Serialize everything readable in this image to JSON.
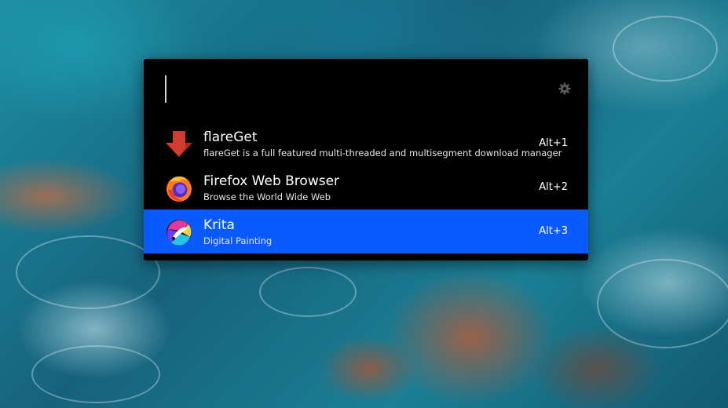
{
  "launcher": {
    "search": {
      "value": "",
      "placeholder": ""
    },
    "settings_icon": "gear-icon",
    "results": [
      {
        "name": "flareGet",
        "description": "flareGet is a full featured multi-threaded and multisegment download manager",
        "shortcut": "Alt+1",
        "icon": "flareget-download-arrow-icon",
        "selected": false
      },
      {
        "name": "Firefox Web Browser",
        "description": "Browse the World Wide Web",
        "shortcut": "Alt+2",
        "icon": "firefox-icon",
        "selected": false
      },
      {
        "name": "Krita",
        "description": "Digital Painting",
        "shortcut": "Alt+3",
        "icon": "krita-icon",
        "selected": true
      }
    ]
  },
  "colors": {
    "launcher_background": "#000000",
    "selection_highlight": "#0a5bff",
    "text": "#ffffff"
  }
}
